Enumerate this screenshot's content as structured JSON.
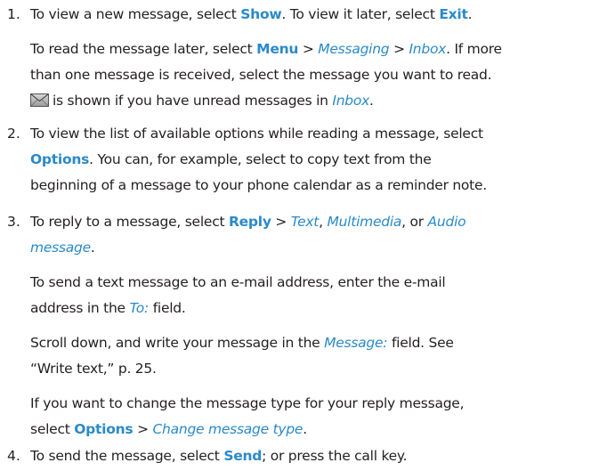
{
  "steps": [
    {
      "number": "1."
    },
    {
      "number": "2."
    },
    {
      "number": "3."
    },
    {
      "number": "4."
    }
  ],
  "text": {
    "s1p1": {
      "a": "To view a new message, select ",
      "show": "Show",
      "b": ". To view it later, select ",
      "exit": "Exit",
      "c": "."
    },
    "s1p2": {
      "a": "To read the message later, select ",
      "menu": "Menu",
      "sep1": " > ",
      "messaging": "Messaging",
      "sep2": " > ",
      "inbox": "Inbox",
      "b": ". If more",
      "l2": "than one message is received, select the message you want to read.",
      "l3a": "is shown if you have unread messages in ",
      "inbox2": "Inbox",
      "l3b": "."
    },
    "s2p1": {
      "l1": "To view the list of available options while reading a message, select",
      "options": "Options",
      "l2b": ". You can, for example, select to copy text from the",
      "l3": "beginning of a message to your phone calendar as a reminder note."
    },
    "s3p1": {
      "a": "To reply to a message, select ",
      "reply": "Reply",
      "sep": " > ",
      "text": "Text",
      "comma1": ", ",
      "multimedia": "Multimedia",
      "or": ", or ",
      "audio": "Audio",
      "message": "message",
      "end": "."
    },
    "s3p2": {
      "l1": "To send a text message to an e-mail address, enter the e-mail",
      "l2a": "address in the ",
      "to": "To:",
      "l2b": " field."
    },
    "s3p3": {
      "a": "Scroll down, and write your message in the ",
      "message": "Message:",
      "b": " field. See",
      "l2": "“Write text,” p. 25."
    },
    "s3p4": {
      "l1": "If you want to change the message type for your reply message,",
      "a": "select ",
      "options": "Options",
      "sep": " > ",
      "change": "Change message type",
      "end": "."
    },
    "s4p1": {
      "a": "To send the message, select ",
      "send": "Send",
      "b": "; or press the call key."
    }
  },
  "icons": {
    "unread": "envelope-icon"
  },
  "colors": {
    "text": "#231f20",
    "accent": "#2a8ac8"
  }
}
